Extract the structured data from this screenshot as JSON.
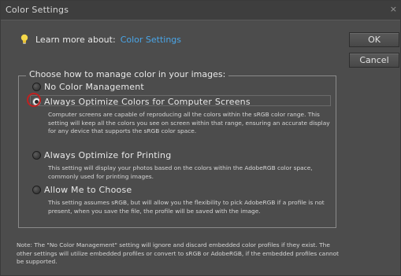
{
  "window": {
    "title": "Color Settings",
    "close_label": "×"
  },
  "learn_more": {
    "prefix": "Learn more about:",
    "link": "Color Settings"
  },
  "buttons": {
    "ok": "OK",
    "cancel": "Cancel"
  },
  "group": {
    "legend": "Choose how to manage color in your images:",
    "options": [
      {
        "label": "No Color Management",
        "checked": false,
        "description": ""
      },
      {
        "label": "Always Optimize Colors for Computer Screens",
        "checked": true,
        "description": "Computer screens are capable of reproducing all the colors within the sRGB color range. This setting will keep all the colors you see on screen within that range, ensuring an accurate display for any device that supports the sRGB color space."
      },
      {
        "label": "Always Optimize for Printing",
        "checked": false,
        "description": "This setting will display your photos based on the colors within the AdobeRGB color space, commonly used for printing images."
      },
      {
        "label": "Allow Me to Choose",
        "checked": false,
        "description": "This setting assumes sRGB, but will allow you the flexibility to pick AdobeRGB if a profile is not present, when you save the file, the profile will be saved with the image."
      }
    ]
  },
  "note": "Note: The \"No Color Management\" setting will ignore and discard embedded color profiles if they exist. The other settings will utilize embedded profiles or convert to sRGB or AdobeRGB, if the embedded profiles cannot be supported.",
  "colors": {
    "background": "#4c4c4c",
    "link": "#4aa6e8",
    "highlight_ring": "#c02020"
  }
}
